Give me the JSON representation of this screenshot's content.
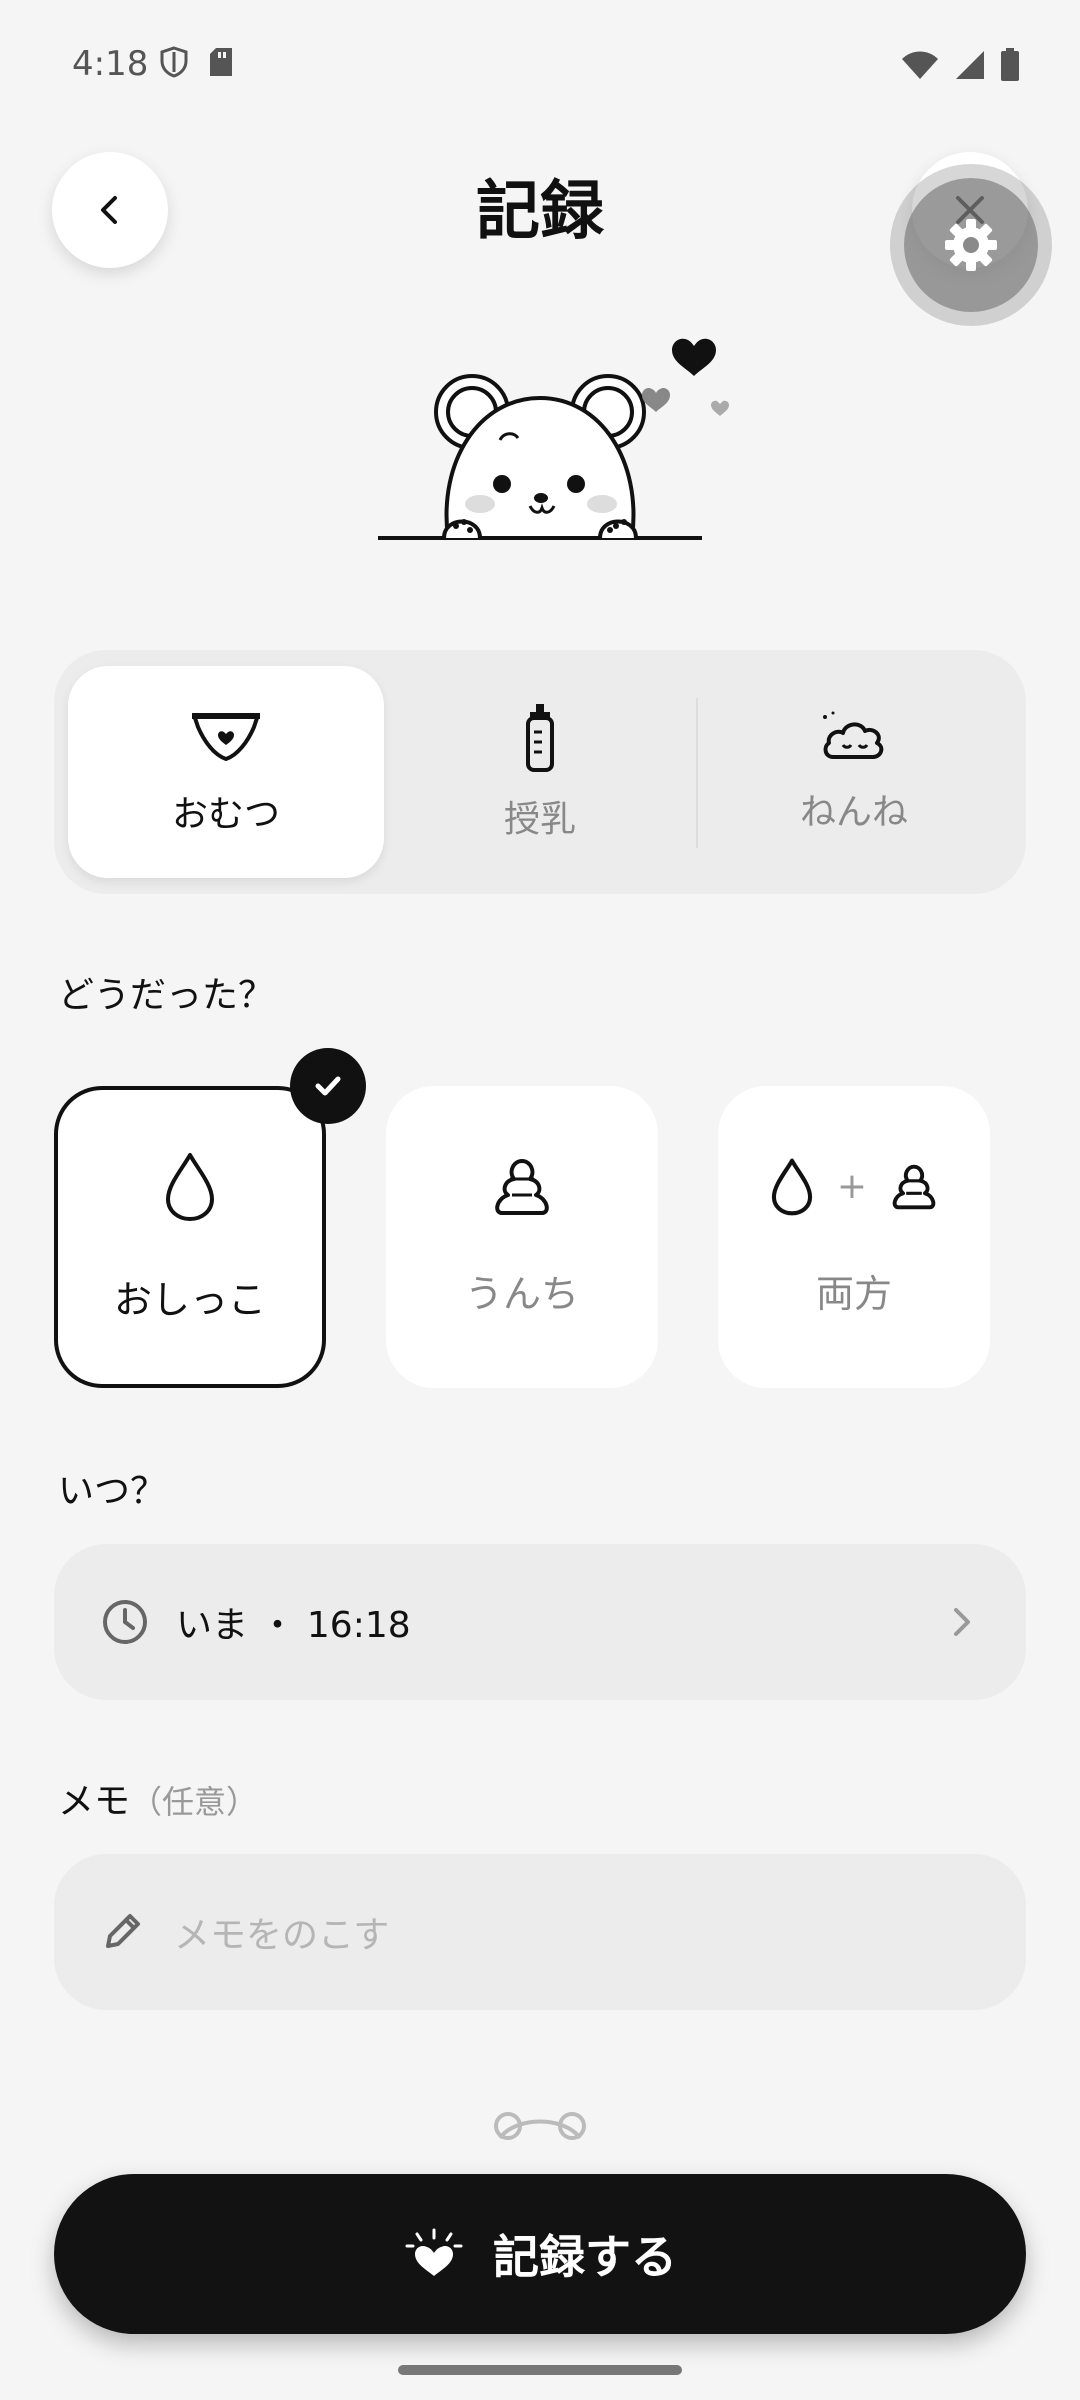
{
  "status_bar": {
    "time": "4:18"
  },
  "header": {
    "title": "記録"
  },
  "categories": [
    {
      "label": "おむつ",
      "icon": "diaper-icon",
      "active": true
    },
    {
      "label": "授乳",
      "icon": "bottle-icon",
      "active": false
    },
    {
      "label": "ねんね",
      "icon": "sleep-cloud-icon",
      "active": false
    }
  ],
  "how": {
    "label": "どうだった？",
    "options": [
      {
        "label": "おしっこ",
        "icon": "drop-icon",
        "selected": true
      },
      {
        "label": "うんち",
        "icon": "poop-icon",
        "selected": false
      },
      {
        "label": "両方",
        "icon": "drop-plus-poop-icon",
        "selected": false,
        "plus": "+"
      }
    ]
  },
  "when": {
    "label": "いつ？",
    "value": "いま ・ 16:18"
  },
  "memo": {
    "label": "メモ",
    "optional": "（任意）",
    "placeholder": "メモをのこす"
  },
  "submit": {
    "label": "記録する"
  },
  "colors": {
    "primary": "#121212",
    "background": "#f5f5f5",
    "field": "#ececec",
    "muted": "#888888"
  }
}
